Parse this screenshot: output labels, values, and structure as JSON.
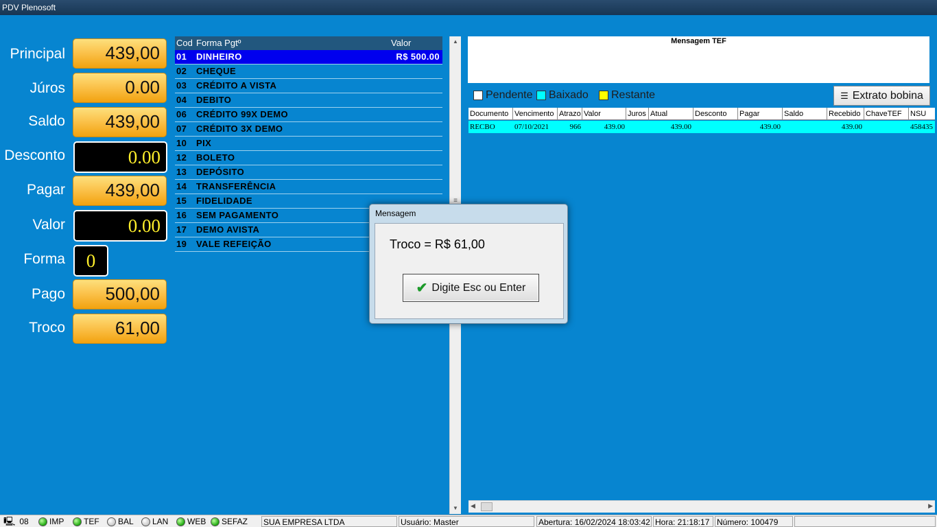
{
  "window": {
    "title": "PDV Plenosoft"
  },
  "summary": [
    {
      "label": "Principal",
      "value": "439,00",
      "style": "orange"
    },
    {
      "label": "Júros",
      "value": "0.00",
      "style": "orange"
    },
    {
      "label": "Saldo",
      "value": "439,00",
      "style": "orange"
    },
    {
      "label": "Desconto",
      "value": "0.00",
      "style": "black"
    },
    {
      "label": "Pagar",
      "value": "439,00",
      "style": "orange"
    },
    {
      "label": "Valor",
      "value": "0.00",
      "style": "black"
    },
    {
      "label": "Forma",
      "value": "0",
      "style": "black"
    },
    {
      "label": "Pago",
      "value": "500,00",
      "style": "orange"
    },
    {
      "label": "Troco",
      "value": "61,00",
      "style": "orange"
    }
  ],
  "payments": {
    "headers": {
      "cod": "Cod",
      "forma": "Forma Pgtº",
      "valor": "Valor"
    },
    "rows": [
      {
        "cod": "01",
        "name": "DINHEIRO",
        "valor": "R$ 500.00",
        "selected": true
      },
      {
        "cod": "02",
        "name": "CHEQUE",
        "valor": ""
      },
      {
        "cod": "03",
        "name": "CRÉDITO A VISTA",
        "valor": ""
      },
      {
        "cod": "04",
        "name": "DEBITO",
        "valor": ""
      },
      {
        "cod": "06",
        "name": "CRÉDITO 99X DEMO",
        "valor": ""
      },
      {
        "cod": "07",
        "name": "CRÉDITO 3X DEMO",
        "valor": ""
      },
      {
        "cod": "10",
        "name": "PIX",
        "valor": ""
      },
      {
        "cod": "12",
        "name": "BOLETO",
        "valor": ""
      },
      {
        "cod": "13",
        "name": "DEPÓSITO",
        "valor": ""
      },
      {
        "cod": "14",
        "name": "TRANSFERÊNCIA",
        "valor": ""
      },
      {
        "cod": "15",
        "name": "FIDELIDADE",
        "valor": ""
      },
      {
        "cod": "16",
        "name": "SEM PAGAMENTO",
        "valor": ""
      },
      {
        "cod": "17",
        "name": "DEMO AVISTA",
        "valor": ""
      },
      {
        "cod": "19",
        "name": "VALE REFEIÇÃO",
        "valor": ""
      }
    ]
  },
  "tef": {
    "title": "Mensagem TEF"
  },
  "legend": {
    "pendente": "Pendente",
    "baixado": "Baixado",
    "restante": "Restante"
  },
  "extrato_button": "Extrato bobina",
  "grid": {
    "headers": [
      "Documento",
      "Vencimento",
      "Atrazo",
      "Valor",
      "Juros",
      "Atual",
      "Desconto",
      "Pagar",
      "Saldo",
      "Recebido",
      "ChaveTEF",
      "NSU"
    ],
    "rows": [
      [
        "RECBO",
        "07/10/2021",
        "966",
        "439.00",
        "",
        "439.00",
        "",
        "439.00",
        "",
        "439.00",
        "",
        "458435"
      ]
    ]
  },
  "dialog": {
    "title": "Mensagem",
    "message": "Troco = R$ 61,00",
    "button": "Digite Esc ou Enter"
  },
  "status": {
    "terminal": "08",
    "indicators": [
      {
        "label": "IMP",
        "on": true
      },
      {
        "label": "TEF",
        "on": true
      },
      {
        "label": "BAL",
        "on": false
      },
      {
        "label": "LAN",
        "on": false
      },
      {
        "label": "WEB",
        "on": true
      },
      {
        "label": "SEFAZ",
        "on": true
      }
    ],
    "company": "SUA EMPRESA LTDA",
    "user": "Usuário: Master",
    "opening": "Abertura: 16/02/2024 18:03:42",
    "time": "Hora: 21:18:17",
    "number": "Número: 100479"
  },
  "colors": {
    "background": "#0785d0",
    "selected_row": "#0000ee",
    "baixado": "#00ffff",
    "restante": "#ffff00",
    "pendente": "#ffffff"
  }
}
